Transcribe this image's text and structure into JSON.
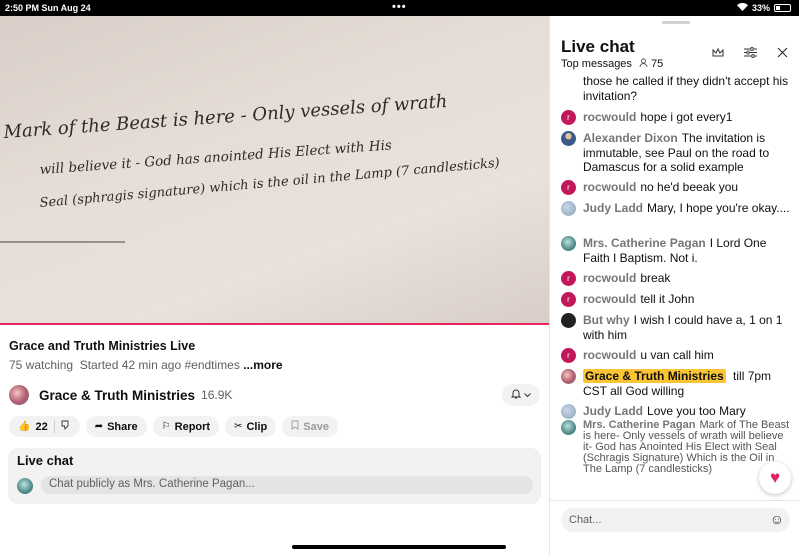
{
  "status_bar": {
    "time": "2:50 PM  Sun Aug 24",
    "dots": "•••",
    "battery": "33%"
  },
  "video": {
    "handwriting": [
      "Mark of the Beast is here - Only vessels of wrath",
      "will believe it - God has anointed His Elect with His",
      "Seal (sphragis signature) which is the oil in the Lamp (7 candlesticks)"
    ]
  },
  "info": {
    "title": "Grace and Truth Ministries Live",
    "watching": "75 watching",
    "started": "Started 42 min ago",
    "hashtag": "#endtimes",
    "more": "...more"
  },
  "channel": {
    "name": "Grace & Truth Ministries",
    "subscribers": "16.9K"
  },
  "actions": {
    "likes": "22",
    "share": "Share",
    "report": "Report",
    "clip": "Clip",
    "save": "Save"
  },
  "live_chat_box": {
    "title": "Live chat",
    "placeholder": "Chat publicly as Mrs. Catherine Pagan..."
  },
  "chat_panel": {
    "title": "Live chat",
    "mode": "Top messages",
    "viewers": "75",
    "partial_top": "those he called if they didn't accept his invitation?",
    "messages": [
      {
        "avatar": "r",
        "author": "rocwould",
        "text": "hope i got every1"
      },
      {
        "avatar": "",
        "author": "Alexander Dixon",
        "text": "The invitation is immutable, see Paul on the road to Damascus for a solid example"
      },
      {
        "avatar": "r",
        "author": "rocwould",
        "text": "no he'd beeak you"
      },
      {
        "avatar": "",
        "author": "Judy Ladd",
        "text": "Mary, I hope you're okay...."
      },
      {
        "avatar": "",
        "author": "Mrs. Catherine Pagan",
        "text": "I Lord One Faith I Baptism. Not i."
      },
      {
        "avatar": "r",
        "author": "rocwould",
        "text": "break"
      },
      {
        "avatar": "r",
        "author": "rocwould",
        "text": "tell it John"
      },
      {
        "avatar": "",
        "author": "But why",
        "text": "I wish I could have a, 1 on 1 with him"
      },
      {
        "avatar": "r",
        "author": "rocwould",
        "text": "u van call him"
      },
      {
        "avatar": "",
        "author": "Grace & Truth Ministries",
        "text": "till 7pm CST all God willing"
      },
      {
        "avatar": "",
        "author": "Judy Ladd",
        "text": "Love you too Mary"
      },
      {
        "avatar": "",
        "author": "Mrs. Catherine Pagan",
        "text": "Mark of The Beast is here- Only vessels of wrath will believe it- God has Anointed His Elect with Seal (Schragis Signature) Which is the Oil in The Lamp (7 candlesticks)"
      }
    ],
    "input_placeholder": "Chat..."
  },
  "colors": {
    "accent": "#e4285e",
    "owner_highlight": "#fbc434",
    "avatar_r": "#c2185b"
  }
}
